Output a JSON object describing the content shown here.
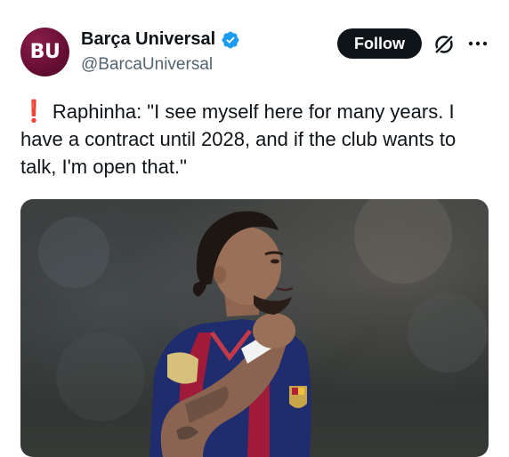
{
  "account": {
    "avatar_text": "BU",
    "display_name": "Barça Universal",
    "handle": "@BarcaUniversal",
    "verified": true
  },
  "actions": {
    "follow_label": "Follow",
    "grok_icon": "grok-icon",
    "more_icon": "more-icon"
  },
  "tweet": {
    "emoji": "❗",
    "text": "Raphinha: \"I see myself here for many years. I have a contract until 2028, and if the club wants to talk, I'm open that.\""
  },
  "colors": {
    "verified_blue": "#1d9bf0",
    "follow_bg": "#0f1419",
    "avatar_bg": "#6a0f35",
    "emoji_red": "#e0242f"
  }
}
